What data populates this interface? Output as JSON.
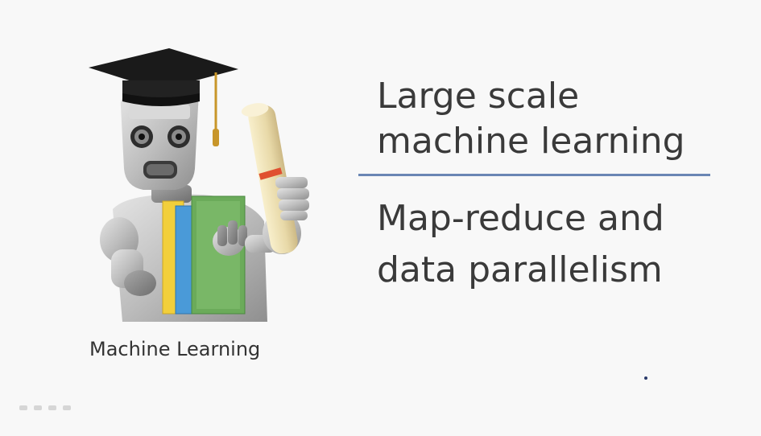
{
  "slide": {
    "title_lines": [
      "Large scale",
      "machine learning"
    ],
    "subtitle_lines": [
      "Map-reduce and",
      "data parallelism"
    ],
    "course_caption": "Machine Learning"
  },
  "colors": {
    "background": "#f8f8f8",
    "text": "#3a3a3a",
    "divider": "#6a86b4",
    "cap": "#1a1a1a",
    "tassel": "#c8962a",
    "robot_body": "#c9c9c9",
    "book_yellow": "#f2cf3b",
    "book_blue": "#4a9ad8",
    "book_green": "#6bab5a",
    "diploma": "#efe2b8",
    "ribbon": "#e05030"
  },
  "icons": {
    "mascot": "robot-graduate-icon"
  }
}
